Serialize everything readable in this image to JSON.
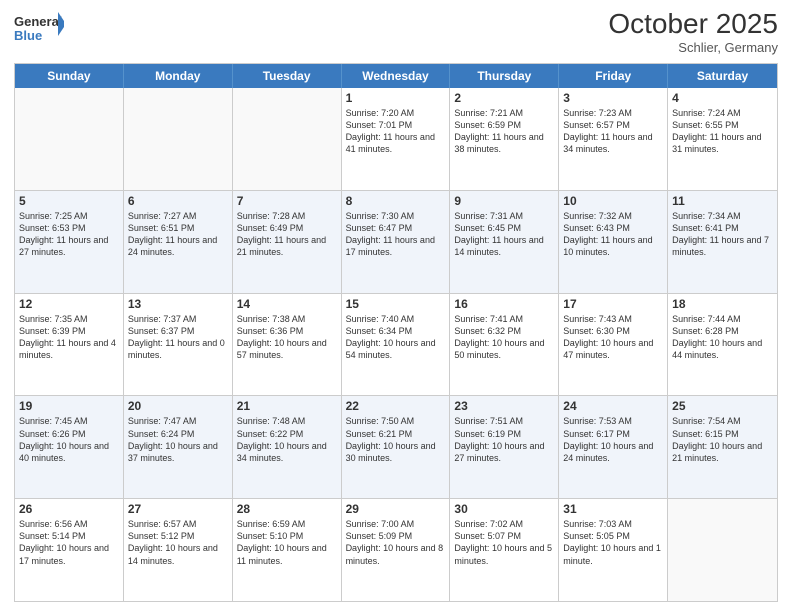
{
  "header": {
    "logo_general": "General",
    "logo_blue": "Blue",
    "month": "October 2025",
    "location": "Schlier, Germany"
  },
  "days_of_week": [
    "Sunday",
    "Monday",
    "Tuesday",
    "Wednesday",
    "Thursday",
    "Friday",
    "Saturday"
  ],
  "rows": [
    {
      "alt": false,
      "cells": [
        {
          "day": "",
          "text": ""
        },
        {
          "day": "",
          "text": ""
        },
        {
          "day": "",
          "text": ""
        },
        {
          "day": "1",
          "text": "Sunrise: 7:20 AM\nSunset: 7:01 PM\nDaylight: 11 hours and 41 minutes."
        },
        {
          "day": "2",
          "text": "Sunrise: 7:21 AM\nSunset: 6:59 PM\nDaylight: 11 hours and 38 minutes."
        },
        {
          "day": "3",
          "text": "Sunrise: 7:23 AM\nSunset: 6:57 PM\nDaylight: 11 hours and 34 minutes."
        },
        {
          "day": "4",
          "text": "Sunrise: 7:24 AM\nSunset: 6:55 PM\nDaylight: 11 hours and 31 minutes."
        }
      ]
    },
    {
      "alt": true,
      "cells": [
        {
          "day": "5",
          "text": "Sunrise: 7:25 AM\nSunset: 6:53 PM\nDaylight: 11 hours and 27 minutes."
        },
        {
          "day": "6",
          "text": "Sunrise: 7:27 AM\nSunset: 6:51 PM\nDaylight: 11 hours and 24 minutes."
        },
        {
          "day": "7",
          "text": "Sunrise: 7:28 AM\nSunset: 6:49 PM\nDaylight: 11 hours and 21 minutes."
        },
        {
          "day": "8",
          "text": "Sunrise: 7:30 AM\nSunset: 6:47 PM\nDaylight: 11 hours and 17 minutes."
        },
        {
          "day": "9",
          "text": "Sunrise: 7:31 AM\nSunset: 6:45 PM\nDaylight: 11 hours and 14 minutes."
        },
        {
          "day": "10",
          "text": "Sunrise: 7:32 AM\nSunset: 6:43 PM\nDaylight: 11 hours and 10 minutes."
        },
        {
          "day": "11",
          "text": "Sunrise: 7:34 AM\nSunset: 6:41 PM\nDaylight: 11 hours and 7 minutes."
        }
      ]
    },
    {
      "alt": false,
      "cells": [
        {
          "day": "12",
          "text": "Sunrise: 7:35 AM\nSunset: 6:39 PM\nDaylight: 11 hours and 4 minutes."
        },
        {
          "day": "13",
          "text": "Sunrise: 7:37 AM\nSunset: 6:37 PM\nDaylight: 11 hours and 0 minutes."
        },
        {
          "day": "14",
          "text": "Sunrise: 7:38 AM\nSunset: 6:36 PM\nDaylight: 10 hours and 57 minutes."
        },
        {
          "day": "15",
          "text": "Sunrise: 7:40 AM\nSunset: 6:34 PM\nDaylight: 10 hours and 54 minutes."
        },
        {
          "day": "16",
          "text": "Sunrise: 7:41 AM\nSunset: 6:32 PM\nDaylight: 10 hours and 50 minutes."
        },
        {
          "day": "17",
          "text": "Sunrise: 7:43 AM\nSunset: 6:30 PM\nDaylight: 10 hours and 47 minutes."
        },
        {
          "day": "18",
          "text": "Sunrise: 7:44 AM\nSunset: 6:28 PM\nDaylight: 10 hours and 44 minutes."
        }
      ]
    },
    {
      "alt": true,
      "cells": [
        {
          "day": "19",
          "text": "Sunrise: 7:45 AM\nSunset: 6:26 PM\nDaylight: 10 hours and 40 minutes."
        },
        {
          "day": "20",
          "text": "Sunrise: 7:47 AM\nSunset: 6:24 PM\nDaylight: 10 hours and 37 minutes."
        },
        {
          "day": "21",
          "text": "Sunrise: 7:48 AM\nSunset: 6:22 PM\nDaylight: 10 hours and 34 minutes."
        },
        {
          "day": "22",
          "text": "Sunrise: 7:50 AM\nSunset: 6:21 PM\nDaylight: 10 hours and 30 minutes."
        },
        {
          "day": "23",
          "text": "Sunrise: 7:51 AM\nSunset: 6:19 PM\nDaylight: 10 hours and 27 minutes."
        },
        {
          "day": "24",
          "text": "Sunrise: 7:53 AM\nSunset: 6:17 PM\nDaylight: 10 hours and 24 minutes."
        },
        {
          "day": "25",
          "text": "Sunrise: 7:54 AM\nSunset: 6:15 PM\nDaylight: 10 hours and 21 minutes."
        }
      ]
    },
    {
      "alt": false,
      "cells": [
        {
          "day": "26",
          "text": "Sunrise: 6:56 AM\nSunset: 5:14 PM\nDaylight: 10 hours and 17 minutes."
        },
        {
          "day": "27",
          "text": "Sunrise: 6:57 AM\nSunset: 5:12 PM\nDaylight: 10 hours and 14 minutes."
        },
        {
          "day": "28",
          "text": "Sunrise: 6:59 AM\nSunset: 5:10 PM\nDaylight: 10 hours and 11 minutes."
        },
        {
          "day": "29",
          "text": "Sunrise: 7:00 AM\nSunset: 5:09 PM\nDaylight: 10 hours and 8 minutes."
        },
        {
          "day": "30",
          "text": "Sunrise: 7:02 AM\nSunset: 5:07 PM\nDaylight: 10 hours and 5 minutes."
        },
        {
          "day": "31",
          "text": "Sunrise: 7:03 AM\nSunset: 5:05 PM\nDaylight: 10 hours and 1 minute."
        },
        {
          "day": "",
          "text": ""
        }
      ]
    }
  ]
}
